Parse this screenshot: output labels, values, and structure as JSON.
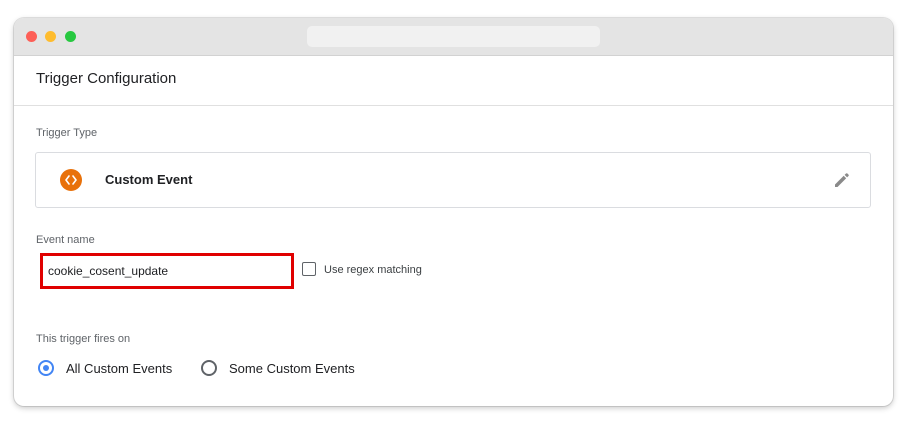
{
  "panel": {
    "title": "Trigger Configuration"
  },
  "trigger_type": {
    "label": "Trigger Type",
    "name": "Custom Event",
    "icon": "code-brackets-icon",
    "icon_color": "#e8710a"
  },
  "event_name": {
    "label": "Event name",
    "value": "cookie_cosent_update",
    "highlight_color": "#e00000",
    "regex_label": "Use regex matching",
    "regex_checked": false
  },
  "fires_on": {
    "label": "This trigger fires on",
    "options": [
      {
        "label": "All Custom Events",
        "selected": true
      },
      {
        "label": "Some Custom Events",
        "selected": false
      }
    ],
    "accent_color": "#4285f4"
  }
}
